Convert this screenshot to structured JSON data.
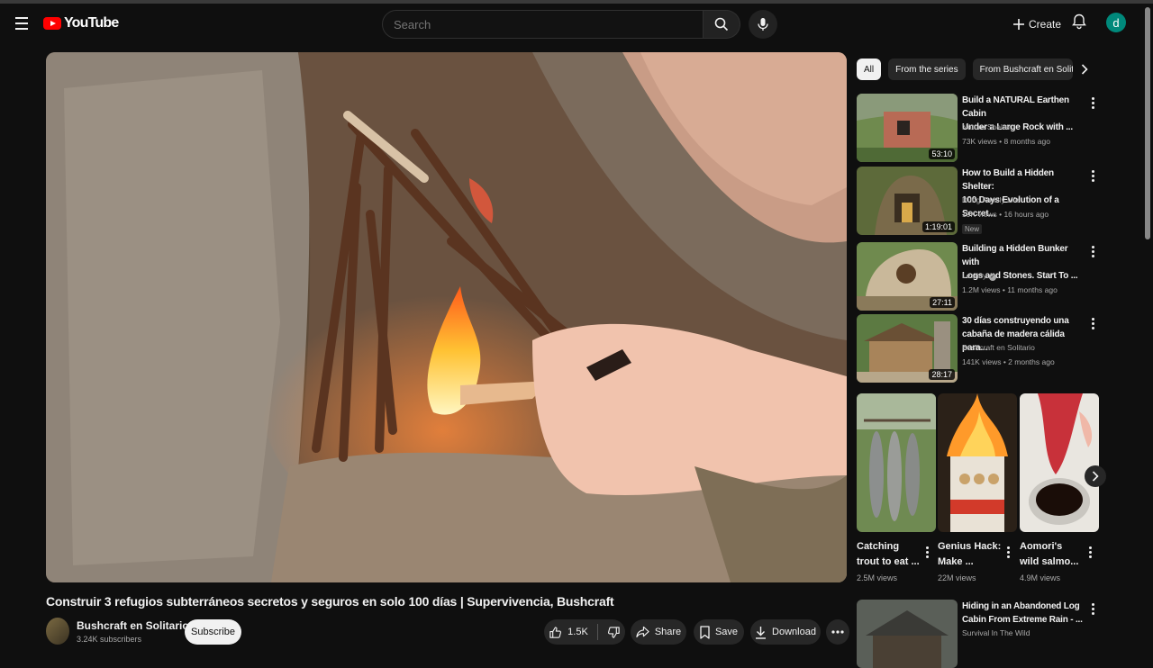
{
  "header": {
    "logo_text": "YouTube",
    "search_placeholder": "Search",
    "create_label": "Create",
    "avatar_letter": "d",
    "colors": {
      "brand": "#ff0000",
      "avatar_bg": "#00897b"
    }
  },
  "video": {
    "title": "Construir 3 refugios subterráneos secretos y seguros en solo 100 días | Supervivencia, Bushcraft",
    "channel_name": "Bushcraft en Solitario",
    "subscribers": "3.24K subscribers",
    "subscribe_label": "Subscribe",
    "likes": "1.5K",
    "share_label": "Share",
    "save_label": "Save",
    "download_label": "Download"
  },
  "chips": [
    "All",
    "From the series",
    "From Bushcraft en Solita"
  ],
  "recommendations": [
    {
      "title_line1": "Build a NATURAL Earthen Cabin",
      "title_line2": "Under a Large Rock with ...",
      "channel": "Nature Shelter",
      "meta": "73K views • 8 months ago",
      "duration": "53:10"
    },
    {
      "title_line1": "How to Build a Hidden Shelter:",
      "title_line2": "100 Days Evolution of a Secret...",
      "channel": "Dũng Family Life",
      "meta": "19K views • 16 hours ago",
      "duration": "1:19:01",
      "badge": "New"
    },
    {
      "title_line1": "Building a Hidden Bunker with",
      "title_line2": "Logs and Stones. Start To ...",
      "channel": "Lesnoy",
      "meta": "1.2M views • 11 months ago",
      "duration": "27:11"
    },
    {
      "title_line1": "30 días construyendo una",
      "title_line2": "cabaña de madera cálida para...",
      "channel": "Bushcraft en Solitario",
      "meta": "141K views • 2 months ago",
      "duration": "28:17"
    },
    {
      "title_line1": "Hiding in an Abandoned Log",
      "title_line2": "Cabin From Extreme Rain - ...",
      "channel": "Survival In The Wild",
      "meta": "",
      "duration": ""
    }
  ],
  "shorts": [
    {
      "title_line1": "Catching",
      "title_line2": "trout to eat ...",
      "views": "2.5M views"
    },
    {
      "title_line1": "Genius Hack:",
      "title_line2": "Make ...",
      "views": "22M views"
    },
    {
      "title_line1": "Aomori's",
      "title_line2": "wild salmo...",
      "views": "4.9M views"
    }
  ]
}
